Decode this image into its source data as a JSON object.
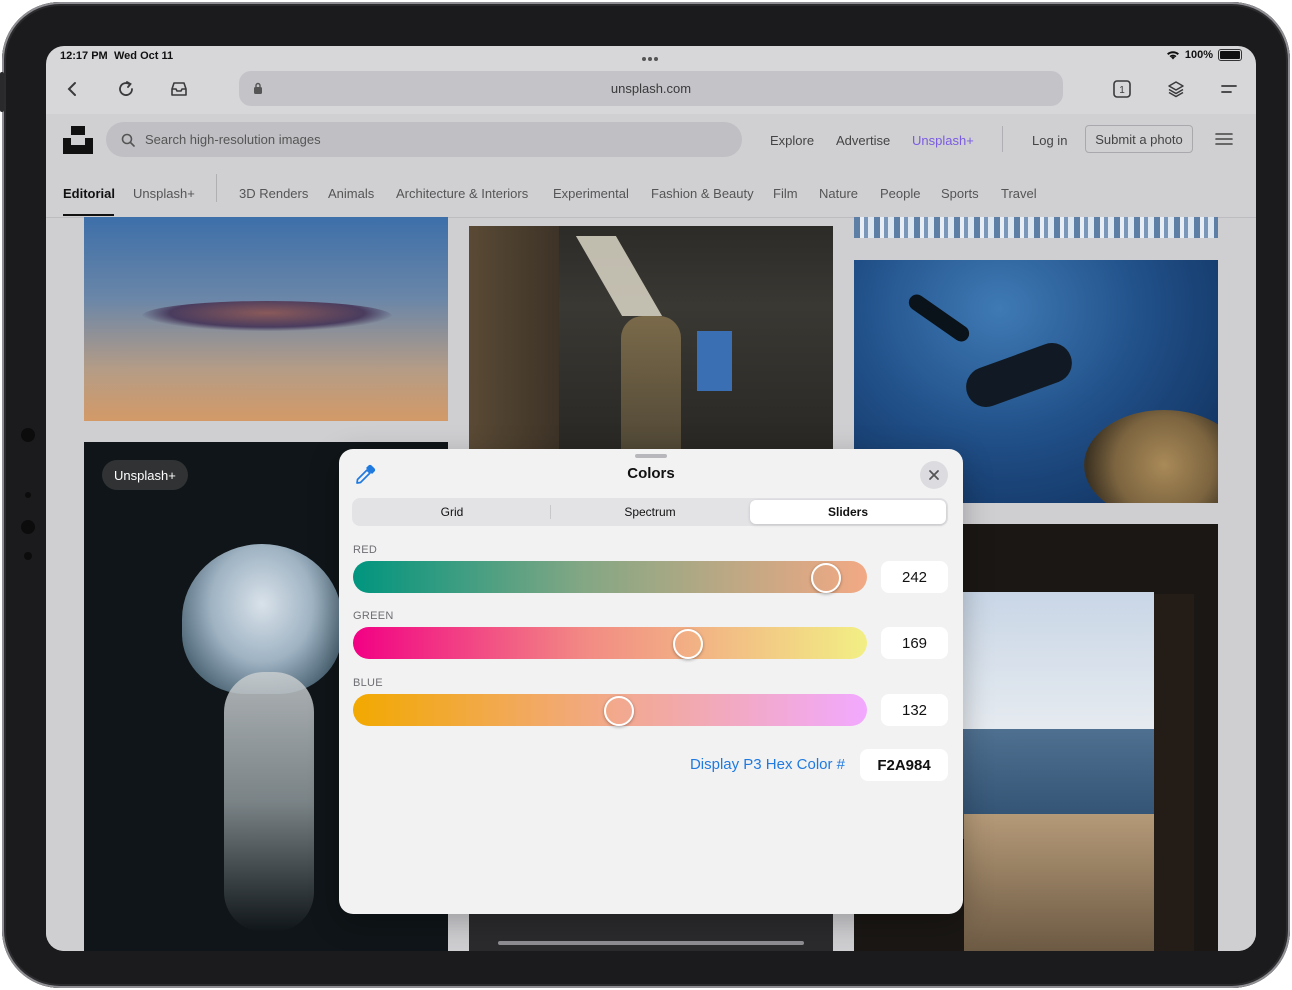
{
  "status_bar": {
    "time": "12:17 PM",
    "date": "Wed Oct 11",
    "battery": "100%"
  },
  "browser": {
    "url": "unsplash.com",
    "tab_count": "1"
  },
  "site": {
    "search_placeholder": "Search high-resolution images",
    "nav": {
      "explore": "Explore",
      "advertise": "Advertise",
      "plus": "Unsplash+",
      "login": "Log in",
      "submit": "Submit a photo"
    },
    "categories": [
      "Editorial",
      "Unsplash+",
      "3D Renders",
      "Animals",
      "Architecture & Interiors",
      "Experimental",
      "Fashion & Beauty",
      "Film",
      "Nature",
      "People",
      "Sports",
      "Travel"
    ],
    "active_category": "Editorial",
    "photo_badge": "Unsplash+"
  },
  "color_picker": {
    "title": "Colors",
    "tabs": [
      "Grid",
      "Spectrum",
      "Sliders"
    ],
    "selected_tab": "Sliders",
    "sliders": [
      {
        "label": "RED",
        "value": "242"
      },
      {
        "label": "GREEN",
        "value": "169"
      },
      {
        "label": "BLUE",
        "value": "132"
      }
    ],
    "hex_label": "Display P3 Hex Color #",
    "hex_value": "F2A984",
    "current_color": "#F2A984"
  },
  "icons": {
    "back": "chevron-left-icon",
    "reload": "reload-icon",
    "share": "tray-icon",
    "tabs": "tabs-icon",
    "layers": "layers-icon",
    "menu": "menu-icon",
    "search": "search-icon",
    "eyedropper": "eyedropper-icon",
    "close": "close-icon"
  }
}
